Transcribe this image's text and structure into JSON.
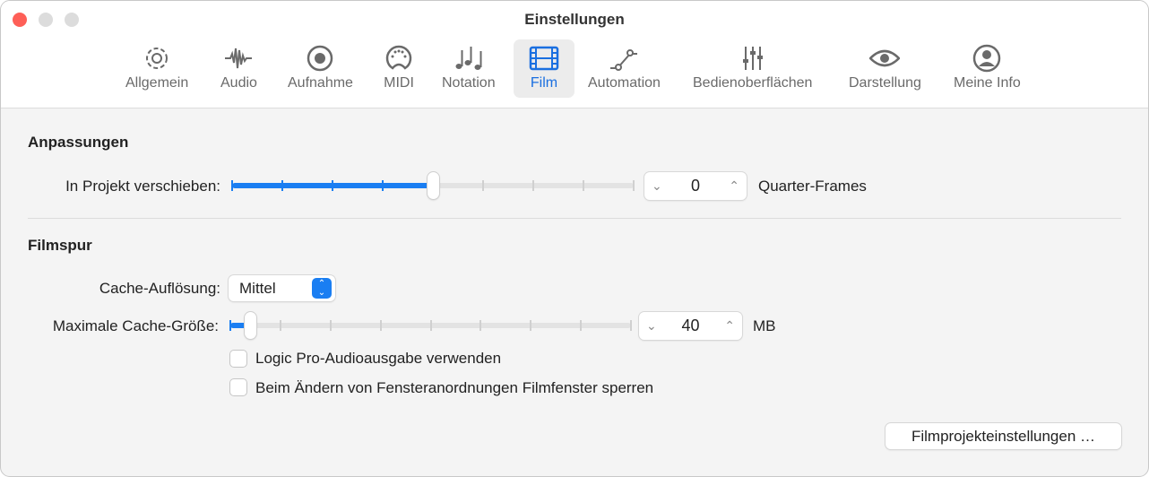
{
  "window": {
    "title": "Einstellungen"
  },
  "toolbar": [
    {
      "label": "Allgemein",
      "icon": "gear-icon"
    },
    {
      "label": "Audio",
      "icon": "waveform-icon"
    },
    {
      "label": "Aufnahme",
      "icon": "record-icon"
    },
    {
      "label": "MIDI",
      "icon": "midi-icon"
    },
    {
      "label": "Notation",
      "icon": "notes-icon"
    },
    {
      "label": "Film",
      "icon": "film-icon",
      "active": true
    },
    {
      "label": "Automation",
      "icon": "automation-icon"
    },
    {
      "label": "Bedienoberflächen",
      "icon": "sliders-icon"
    },
    {
      "label": "Darstellung",
      "icon": "eye-icon"
    },
    {
      "label": "Meine Info",
      "icon": "person-icon"
    }
  ],
  "anpassungen": {
    "heading": "Anpassungen",
    "offset_label": "In Projekt verschieben:",
    "offset_slider_percent": 50,
    "offset_value": "0",
    "offset_unit": "Quarter-Frames"
  },
  "filmspur": {
    "heading": "Filmspur",
    "cache_res_label": "Cache-Auflösung:",
    "cache_res_value": "Mittel",
    "cache_size_label": "Maximale Cache-Größe:",
    "cache_size_slider_percent": 5,
    "cache_size_value": "40",
    "cache_size_unit": "MB",
    "checkbox1": {
      "label": "Logic Pro-Audioausgabe verwenden",
      "checked": false
    },
    "checkbox2": {
      "label": "Beim Ändern von Fensteranordnungen Filmfenster sperren",
      "checked": false
    },
    "project_button": "Filmprojekteinstellungen …"
  },
  "colors": {
    "accent": "#1a7ef2",
    "close": "#fe5f57",
    "disabled": "#dcdcdc"
  }
}
